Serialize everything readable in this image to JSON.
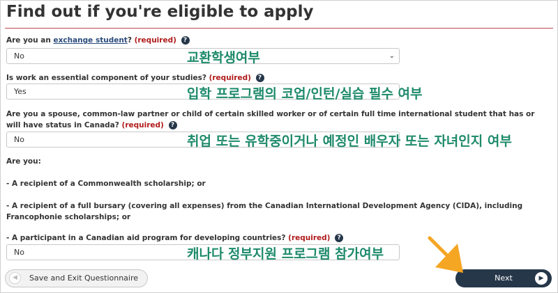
{
  "page": {
    "title": "Find out if you're eligible to apply"
  },
  "questions": {
    "exchange": {
      "prefix": "Are you an ",
      "link": "exchange student",
      "suffix": "?",
      "required": "(required)",
      "value": "No",
      "note": "교환학생여부"
    },
    "work": {
      "text": "Is work an essential component of your studies?",
      "required": "(required)",
      "value": "Yes",
      "note": "입학 프로그램의 코업/인턴/실습 필수 여부"
    },
    "spouse": {
      "text": "Are you a spouse, common-law partner or child of certain skilled worker or of certain full time international student that has or will have status in Canada?",
      "required": "(required)",
      "value": "No",
      "note": "취업 또는 유학중이거나 예정인 배우자 또는 자녀인지 여부"
    },
    "are_you": {
      "heading": "Are you:",
      "items": [
        "-  A recipient of a Commonwealth scholarship; or",
        "-  A recipient of a full bursary (covering all expenses) from the Canadian International Development Agency (CIDA), including Francophonie scholarships; or"
      ]
    },
    "aid": {
      "text": "-  A participant in a Canadian aid program for developing countries?",
      "required": "(required)",
      "value": "No",
      "note": "캐나다 정부지원 프로그램 참가여부"
    }
  },
  "buttons": {
    "save_label": "Save and Exit Questionnaire",
    "next_label": "Next"
  },
  "icons": {
    "help": "help-icon",
    "back": "arrow-left-icon",
    "next": "play-icon"
  },
  "colors": {
    "required": "#b01a1a",
    "primary_button": "#26374a",
    "overlay_text": "#1e8a6a",
    "arrow": "#f5a623"
  }
}
